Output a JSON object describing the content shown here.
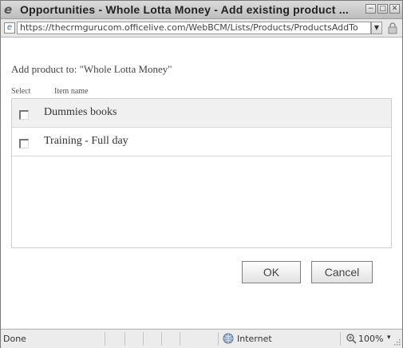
{
  "window": {
    "title": "Opportunities - Whole Lotta Money - Add existing product ...",
    "minimize_glyph": "−",
    "maximize_glyph": "□",
    "close_glyph": "✕"
  },
  "address_bar": {
    "url": "https://thecrmgurucom.officelive.com/WebBCM/Lists/Products/ProductsAddTo",
    "dropdown_glyph": "▼"
  },
  "dialog": {
    "add_label": "Add product to: \"Whole Lotta Money\"",
    "columns": {
      "select": "Select",
      "item_name": "Item name"
    },
    "items": [
      {
        "name": "Dummies books",
        "checked": false
      },
      {
        "name": "Training - Full day",
        "checked": false
      }
    ],
    "ok_label": "OK",
    "cancel_label": "Cancel"
  },
  "status_bar": {
    "status": "Done",
    "zone": "Internet",
    "zoom": "100%",
    "zoom_dropdown": "▾"
  },
  "icons": {
    "title_icon": "ie-logo-icon",
    "page_icon": "page-icon",
    "lock": "lock-icon",
    "zone": "globe-icon",
    "zoom": "magnifier-icon"
  }
}
